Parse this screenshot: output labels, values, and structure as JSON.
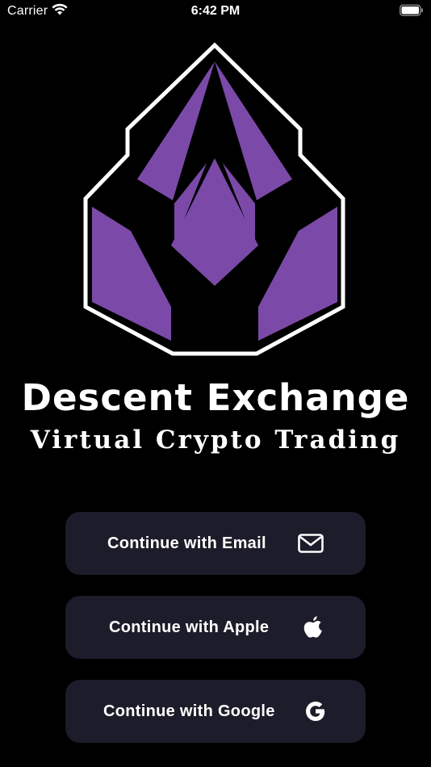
{
  "status_bar": {
    "carrier": "Carrier",
    "time": "6:42 PM"
  },
  "brand": {
    "title": "Descent Exchange",
    "subtitle": "Virtual Crypto Trading",
    "accent_color": "#7b4aa8"
  },
  "auth": {
    "buttons": [
      {
        "label": "Continue with Email",
        "icon": "envelope-icon"
      },
      {
        "label": "Continue with Apple",
        "icon": "apple-icon"
      },
      {
        "label": "Continue with Google",
        "icon": "google-icon"
      }
    ]
  },
  "colors": {
    "background": "#000000",
    "button_background": "#1c1c2a",
    "text": "#ffffff"
  }
}
